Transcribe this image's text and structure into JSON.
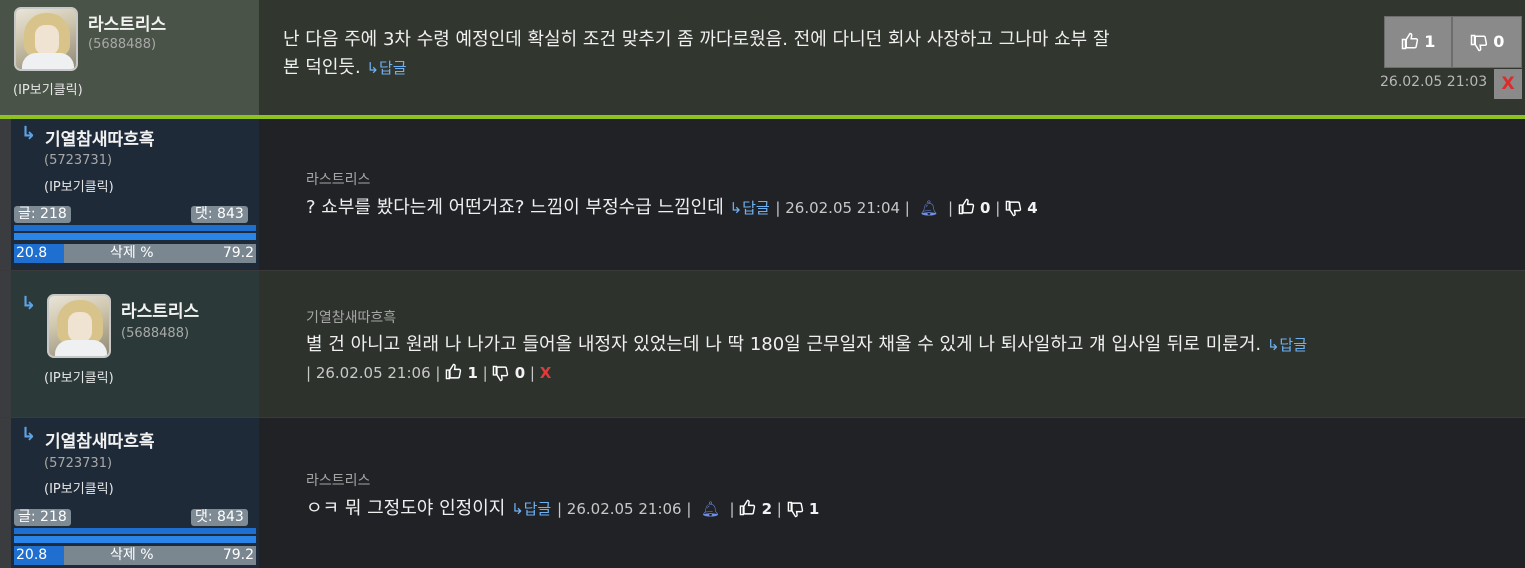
{
  "comments": [
    {
      "username": "라스트리스",
      "user_id": "(5688488)",
      "ip_label": "(IP보기클릭)",
      "text_line1": "난 다음 주에 3차 수령 예정인데 확실히 조건 맞추기 좀 까다로웠음. 전에 다니던 회사 사장하고 그나마 쇼부 잘",
      "text_line2": "본 덕인듯.",
      "reply_label": "↳답글",
      "likes": "1",
      "dislikes": "0",
      "date": "26.02.05 21:03",
      "delete_label": "X"
    },
    {
      "reply_arrow": "↳",
      "username": "기열참새따흐흑",
      "user_id": "(5723731)",
      "ip_label": "(IP보기클릭)",
      "posts_label": "글: 218",
      "comments_label": "댓: 843",
      "ratio_left": "20.8",
      "ratio_mid": "삭제 %",
      "ratio_right": "79.2",
      "reply_to": "라스트리스",
      "text": "? 쇼부를 봤다는게 어떤거죠? 느낌이 부정수급 느낌인데",
      "reply_label": "↳답글",
      "date": "26.02.05 21:04",
      "likes": "0",
      "dislikes": "4"
    },
    {
      "reply_arrow": "↳",
      "username": "라스트리스",
      "user_id": "(5688488)",
      "ip_label": "(IP보기클릭)",
      "reply_to": "기열참새따흐흑",
      "text": "별 건 아니고 원래 나 나가고 들어올 내정자 있었는데 나 딱 180일 근무일자 채울 수 있게 나 퇴사일하고 걔 입사일 뒤로 미룬거.",
      "reply_label": "↳답글",
      "date": "26.02.05 21:06",
      "likes": "1",
      "dislikes": "0",
      "delete_label": "X"
    },
    {
      "reply_arrow": "↳",
      "username": "기열참새따흐흑",
      "user_id": "(5723731)",
      "ip_label": "(IP보기클릭)",
      "posts_label": "글: 218",
      "comments_label": "댓: 843",
      "ratio_left": "20.8",
      "ratio_mid": "삭제 %",
      "ratio_right": "79.2",
      "reply_to": "라스트리스",
      "text": "ㅇㅋ 뭐 그정도야 인정이지",
      "reply_label": "↳답글",
      "date": "26.02.05 21:06",
      "likes": "2",
      "dislikes": "1"
    }
  ],
  "colors": {
    "accent_line": "#8dc21f",
    "link": "#6fb0f0",
    "danger": "#e23a3a"
  },
  "icons": {
    "like": "thumbs-up-icon",
    "dislike": "thumbs-down-icon",
    "bell": "bell-icon",
    "reply": "reply-arrow-icon"
  }
}
